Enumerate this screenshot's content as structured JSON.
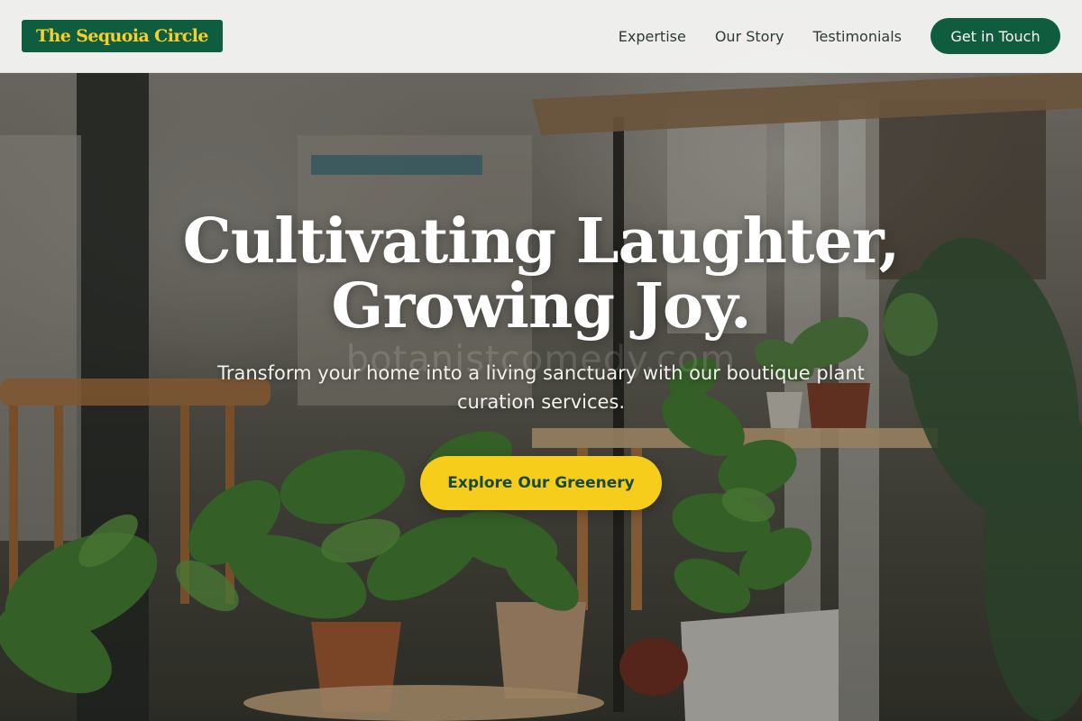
{
  "header": {
    "logo_text": "The Sequoia Circle",
    "nav": [
      {
        "label": "Expertise"
      },
      {
        "label": "Our Story"
      },
      {
        "label": "Testimonials"
      }
    ],
    "cta_label": "Get in Touch"
  },
  "hero": {
    "title_line1": "Cultivating Laughter,",
    "title_line2": "Growing Joy.",
    "subtitle": "Transform your home into a living sanctuary with our boutique plant curation services.",
    "cta_label": "Explore Our Greenery",
    "watermark": "botanistcomedy.com",
    "background_image": "indoor-plants-cafe-photo"
  },
  "colors": {
    "brand_green": "#0f5c3e",
    "brand_yellow": "#f7cd1c",
    "header_bg": "#fafaf9",
    "nav_text": "#2d3a36"
  }
}
